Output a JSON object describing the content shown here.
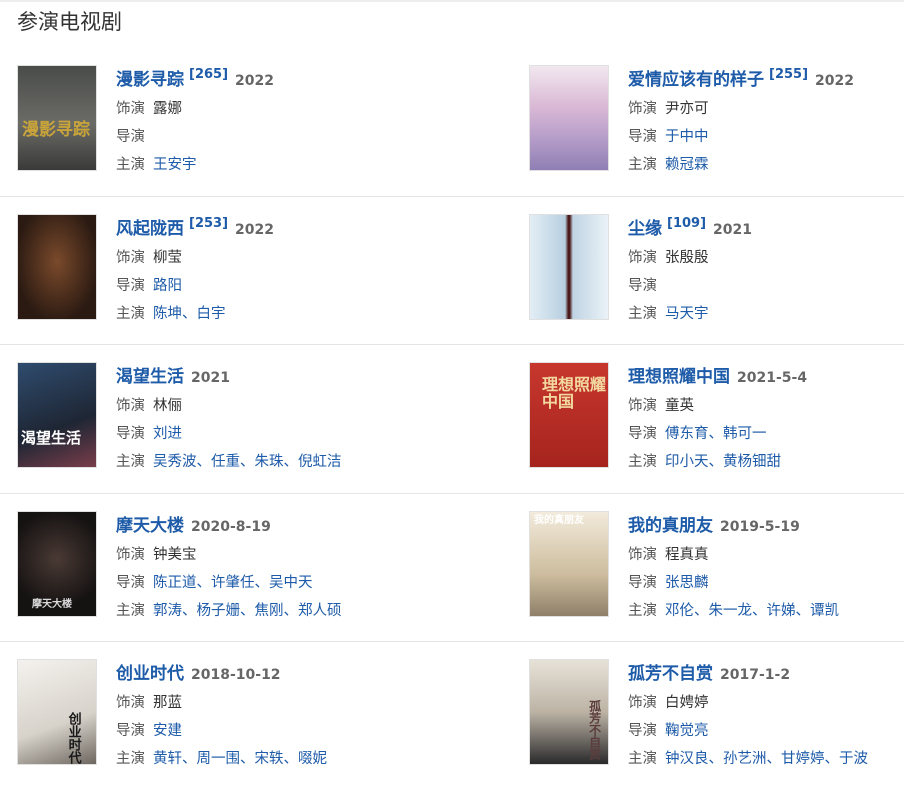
{
  "section_title": "参演电视剧",
  "labels": {
    "role": "饰演",
    "director": "导演",
    "lead": "主演"
  },
  "items": [
    {
      "title": "漫影寻踪",
      "sup": "[265]",
      "year": "2022",
      "role": "露娜",
      "director": "",
      "lead": "王安宇",
      "poster_text": "漫影寻踪",
      "poster_color": "#5b5d5a"
    },
    {
      "title": "爱情应该有的样子",
      "sup": "[255]",
      "year": "2022",
      "role": "尹亦可",
      "director": "于中中",
      "lead": "赖冠霖",
      "poster_text": "",
      "poster_color": "#d8c7e0"
    },
    {
      "title": "风起陇西",
      "sup": "[253]",
      "year": "2022",
      "role": "柳莹",
      "director": "路阳",
      "lead": "陈坤、白宇",
      "poster_text": "",
      "poster_color": "#3a2419"
    },
    {
      "title": "尘缘",
      "sup": "[109]",
      "year": "2021",
      "role": "张殷殷",
      "director": "",
      "lead": "马天宇",
      "poster_text": "",
      "poster_color": "#c9dbe8"
    },
    {
      "title": "渴望生活",
      "sup": "",
      "year": "2021",
      "role": "林俪",
      "director": "刘进",
      "lead": "吴秀波、任重、朱珠、倪虹洁",
      "poster_text": "渴望生活",
      "poster_color": "#3c4552"
    },
    {
      "title": "理想照耀中国",
      "sup": "",
      "year": "2021-5-4",
      "role": "童英",
      "director": "傅东育、韩可一",
      "lead": "印小天、黄杨钿甜",
      "poster_text": "理想照耀中国",
      "poster_color": "#b8312a"
    },
    {
      "title": "摩天大楼",
      "sup": "",
      "year": "2020-8-19",
      "role": "钟美宝",
      "director": "陈正道、许肇任、吴中天",
      "lead": "郭涛、杨子姗、焦刚、郑人硕",
      "poster_text": "摩天大楼",
      "poster_color": "#1f1a1a"
    },
    {
      "title": "我的真朋友",
      "sup": "",
      "year": "2019-5-19",
      "role": "程真真",
      "director": "张思麟",
      "lead": "邓伦、朱一龙、许娣、谭凯",
      "poster_text": "我的真朋友",
      "poster_color": "#d9cbb0"
    },
    {
      "title": "创业时代",
      "sup": "",
      "year": "2018-10-12",
      "role": "那蓝",
      "director": "安建",
      "lead": "黄轩、周一围、宋轶、啜妮",
      "poster_text": "创业时代",
      "poster_color": "#e9e6e1"
    },
    {
      "title": "孤芳不自赏",
      "sup": "",
      "year": "2017-1-2",
      "role": "白娉婷",
      "director": "鞠觉亮",
      "lead": "钟汉良、孙艺洲、甘婷婷、于波",
      "poster_text": "孤芳不自赏",
      "poster_color": "#dcd6cc"
    }
  ]
}
